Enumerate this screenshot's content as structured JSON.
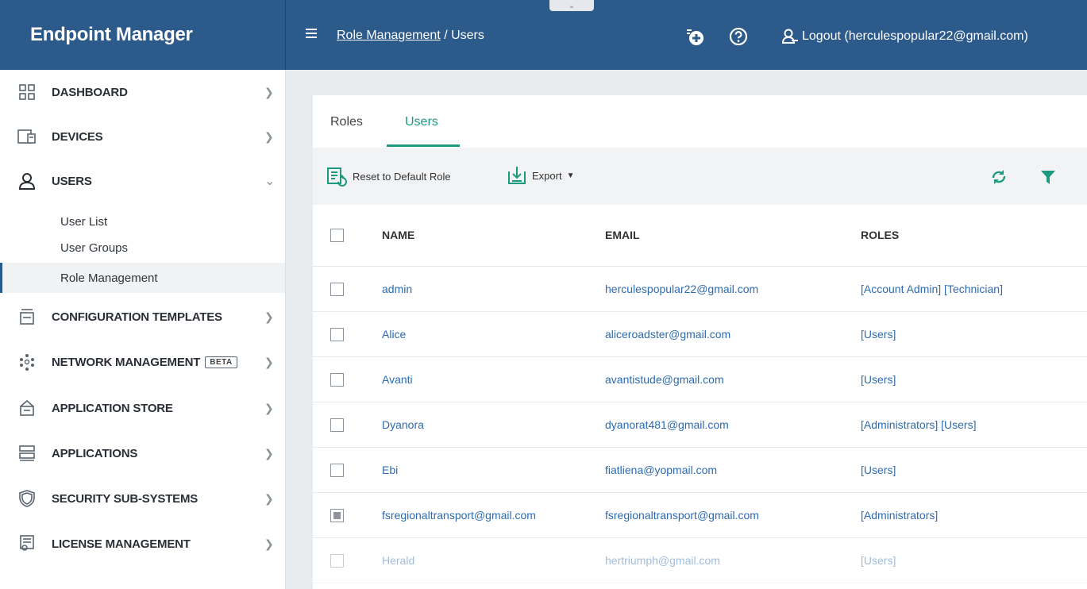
{
  "app": {
    "title": "Endpoint Manager"
  },
  "header": {
    "breadcrumb_link": "Role Management",
    "breadcrumb_sep": " / ",
    "breadcrumb_current": "Users",
    "logout_label": "Logout (herculespopular22@gmail.com)",
    "pull_tab_glyph": "⌄"
  },
  "sidebar": {
    "items": [
      {
        "label": "DASHBOARD",
        "icon": "dashboard-icon"
      },
      {
        "label": "DEVICES",
        "icon": "devices-icon"
      },
      {
        "label": "USERS",
        "icon": "user-icon",
        "expanded": true
      },
      {
        "label": "CONFIGURATION TEMPLATES",
        "icon": "templates-icon"
      },
      {
        "label": "NETWORK MANAGEMENT",
        "icon": "network-icon",
        "badge": "BETA"
      },
      {
        "label": "APPLICATION STORE",
        "icon": "store-icon"
      },
      {
        "label": "APPLICATIONS",
        "icon": "applications-icon"
      },
      {
        "label": "SECURITY SUB-SYSTEMS",
        "icon": "shield-icon"
      },
      {
        "label": "LICENSE MANAGEMENT",
        "icon": "license-icon"
      }
    ],
    "users_subitems": [
      {
        "label": "User List"
      },
      {
        "label": "User Groups"
      },
      {
        "label": "Role Management",
        "active": true
      }
    ]
  },
  "tabs": [
    {
      "label": "Roles",
      "active": false
    },
    {
      "label": "Users",
      "active": true
    }
  ],
  "toolbar": {
    "reset_label": "Reset to Default Role",
    "export_label": "Export"
  },
  "table": {
    "headers": {
      "name": "NAME",
      "email": "EMAIL",
      "roles": "ROLES"
    },
    "rows": [
      {
        "name": "admin",
        "email": "herculespopular22@gmail.com",
        "roles": "[Account Admin] [Technician]"
      },
      {
        "name": "Alice",
        "email": "aliceroadster@gmail.com",
        "roles": "[Users]"
      },
      {
        "name": "Avanti",
        "email": "avantistude@gmail.com",
        "roles": "[Users]"
      },
      {
        "name": "Dyanora",
        "email": "dyanorat481@gmail.com",
        "roles": "[Administrators] [Users]"
      },
      {
        "name": "Ebi",
        "email": "fiatliena@yopmail.com",
        "roles": "[Users]"
      },
      {
        "name": "fsregionaltransport@gmail.com",
        "email": "fsregionaltransport@gmail.com",
        "roles": "[Administrators]",
        "checked": "partial"
      },
      {
        "name": "Herald",
        "email": "hertriumph@gmail.com",
        "roles": "[Users]"
      }
    ]
  },
  "colors": {
    "header_bg": "#2c5a8a",
    "accent_green": "#1c9a7e",
    "link_blue": "#2d6bb0"
  }
}
